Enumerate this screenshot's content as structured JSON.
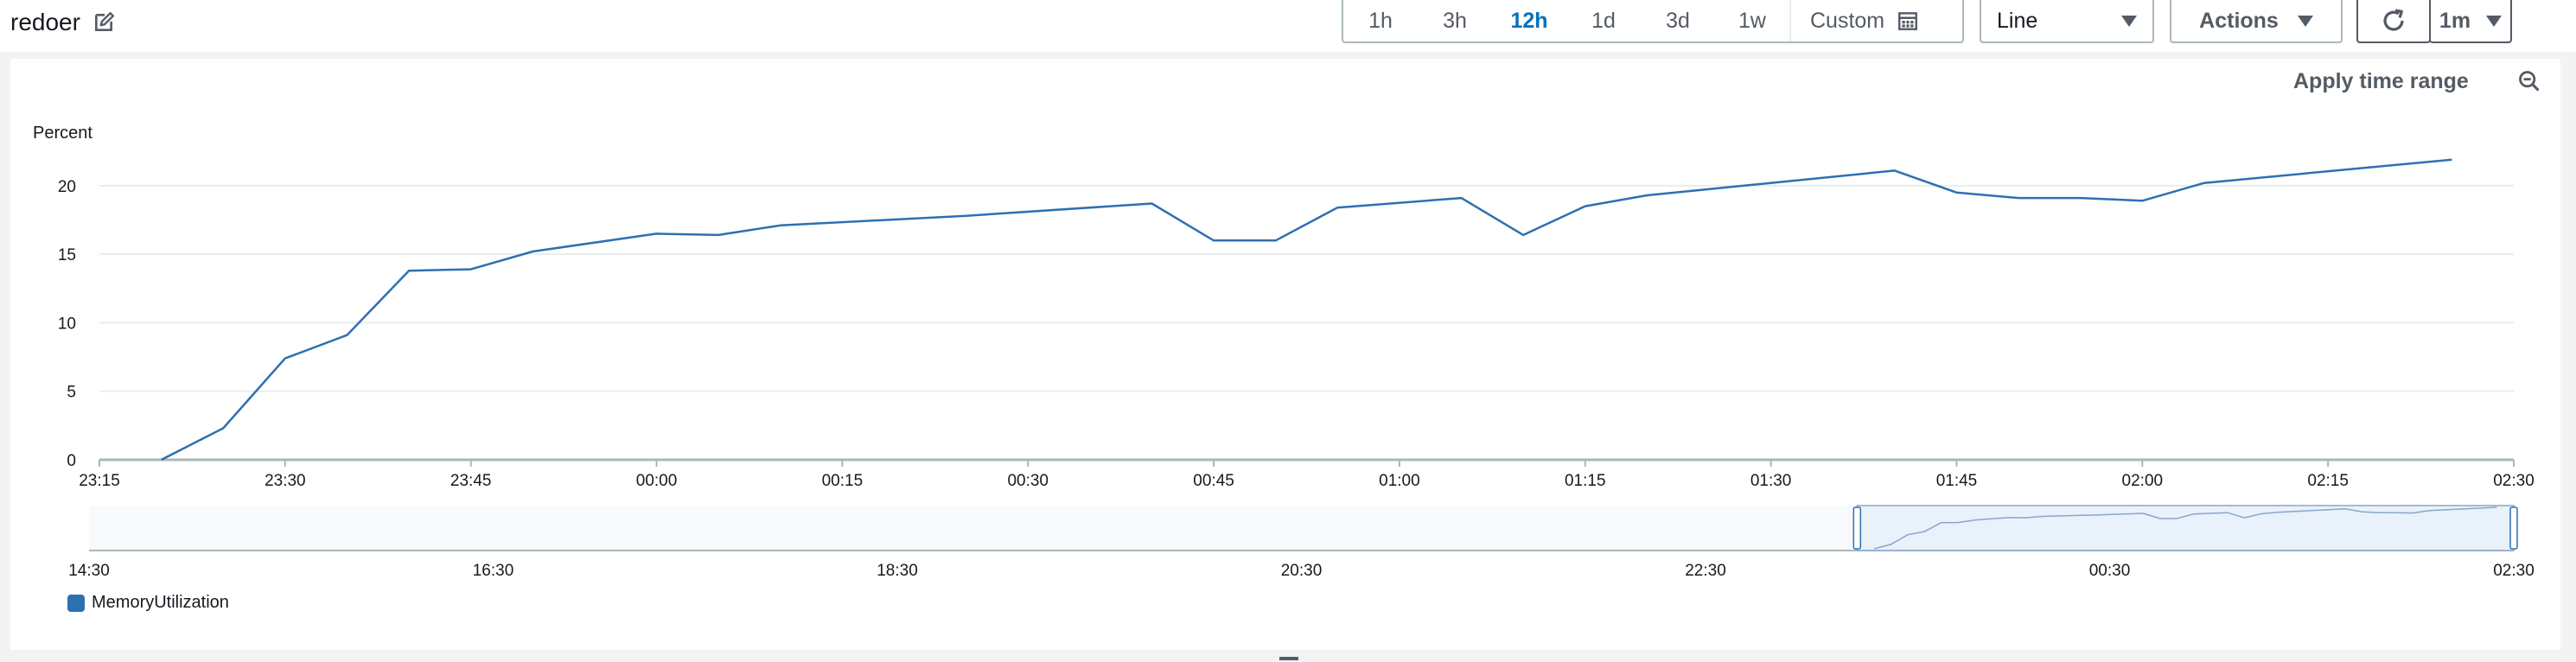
{
  "widget": {
    "title": "redoer",
    "edit_icon": "edit-icon"
  },
  "toolbar": {
    "time_ranges": [
      "1h",
      "3h",
      "12h",
      "1d",
      "3d",
      "1w"
    ],
    "active_range": "12h",
    "custom_label": "Custom",
    "chart_type_select": "Line",
    "actions_label": "Actions",
    "refresh_icon": "refresh-icon",
    "refresh_interval": "1m"
  },
  "panel": {
    "apply_time_range_label": "Apply time range",
    "zoom_out_icon": "zoom-out-icon"
  },
  "legend": {
    "series_name": "MemoryUtilization",
    "color": "#2d70b1"
  },
  "colors": {
    "active_range": "#0073bb",
    "series": "#2d70b1",
    "navigator_fill": "#e9f1fb"
  },
  "chart_data": {
    "type": "line",
    "ylabel": "Percent",
    "ylim": [
      0,
      21
    ],
    "yticks": [
      0,
      5,
      10,
      15,
      20
    ],
    "xticks": [
      "23:15",
      "23:30",
      "23:45",
      "00:00",
      "00:15",
      "00:30",
      "00:45",
      "01:00",
      "01:15",
      "01:30",
      "01:45",
      "02:00",
      "02:15",
      "02:30"
    ],
    "grid": true,
    "legend_position": "bottom-left",
    "series": [
      {
        "name": "MemoryUtilization",
        "points": [
          [
            "23:20",
            0
          ],
          [
            "23:25",
            2.3
          ],
          [
            "23:30",
            7.4
          ],
          [
            "23:35",
            9.1
          ],
          [
            "23:40",
            13.8
          ],
          [
            "23:45",
            13.9
          ],
          [
            "23:50",
            15.2
          ],
          [
            "00:00",
            16.5
          ],
          [
            "00:05",
            16.4
          ],
          [
            "00:10",
            17.1
          ],
          [
            "00:25",
            17.8
          ],
          [
            "00:40",
            18.7
          ],
          [
            "00:45",
            16.0
          ],
          [
            "00:50",
            16.0
          ],
          [
            "00:55",
            18.4
          ],
          [
            "01:05",
            19.1
          ],
          [
            "01:10",
            16.4
          ],
          [
            "01:15",
            18.5
          ],
          [
            "01:20",
            19.3
          ],
          [
            "01:40",
            21.1
          ],
          [
            "01:45",
            19.5
          ],
          [
            "01:50",
            19.1
          ],
          [
            "01:55",
            19.1
          ],
          [
            "02:00",
            18.9
          ],
          [
            "02:05",
            20.2
          ],
          [
            "02:25",
            21.9
          ]
        ]
      }
    ],
    "navigator": {
      "xticks": [
        "14:30",
        "16:30",
        "18:30",
        "20:30",
        "22:30",
        "00:30",
        "02:30"
      ],
      "selection": [
        "23:15",
        "02:30"
      ]
    }
  }
}
